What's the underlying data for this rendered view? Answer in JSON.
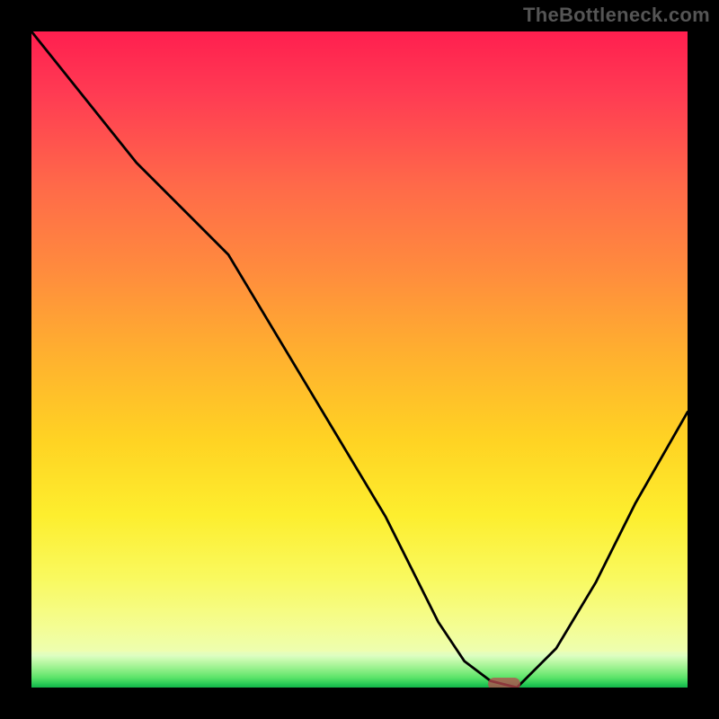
{
  "watermark": "TheBottleneck.com",
  "colors": {
    "top": "#ff1f4f",
    "mid": "#ffd323",
    "bottom_green": "#22c653",
    "marker": "#b94a4f",
    "curve": "#000000",
    "frame": "#000000"
  },
  "chart_data": {
    "type": "line",
    "title": "",
    "xlabel": "",
    "ylabel": "",
    "xlim": [
      0,
      1
    ],
    "ylim": [
      0,
      1
    ],
    "series": [
      {
        "name": "bottleneck-curve",
        "x": [
          0.0,
          0.08,
          0.16,
          0.24,
          0.3,
          0.36,
          0.42,
          0.48,
          0.54,
          0.58,
          0.62,
          0.66,
          0.7,
          0.74,
          0.8,
          0.86,
          0.92,
          1.0
        ],
        "y": [
          1.0,
          0.9,
          0.8,
          0.72,
          0.66,
          0.56,
          0.46,
          0.36,
          0.26,
          0.18,
          0.1,
          0.04,
          0.01,
          0.0,
          0.06,
          0.16,
          0.28,
          0.42
        ]
      }
    ],
    "annotations": [
      {
        "name": "optimal-marker",
        "x": 0.72,
        "y": 0.005,
        "shape": "pill"
      }
    ]
  }
}
